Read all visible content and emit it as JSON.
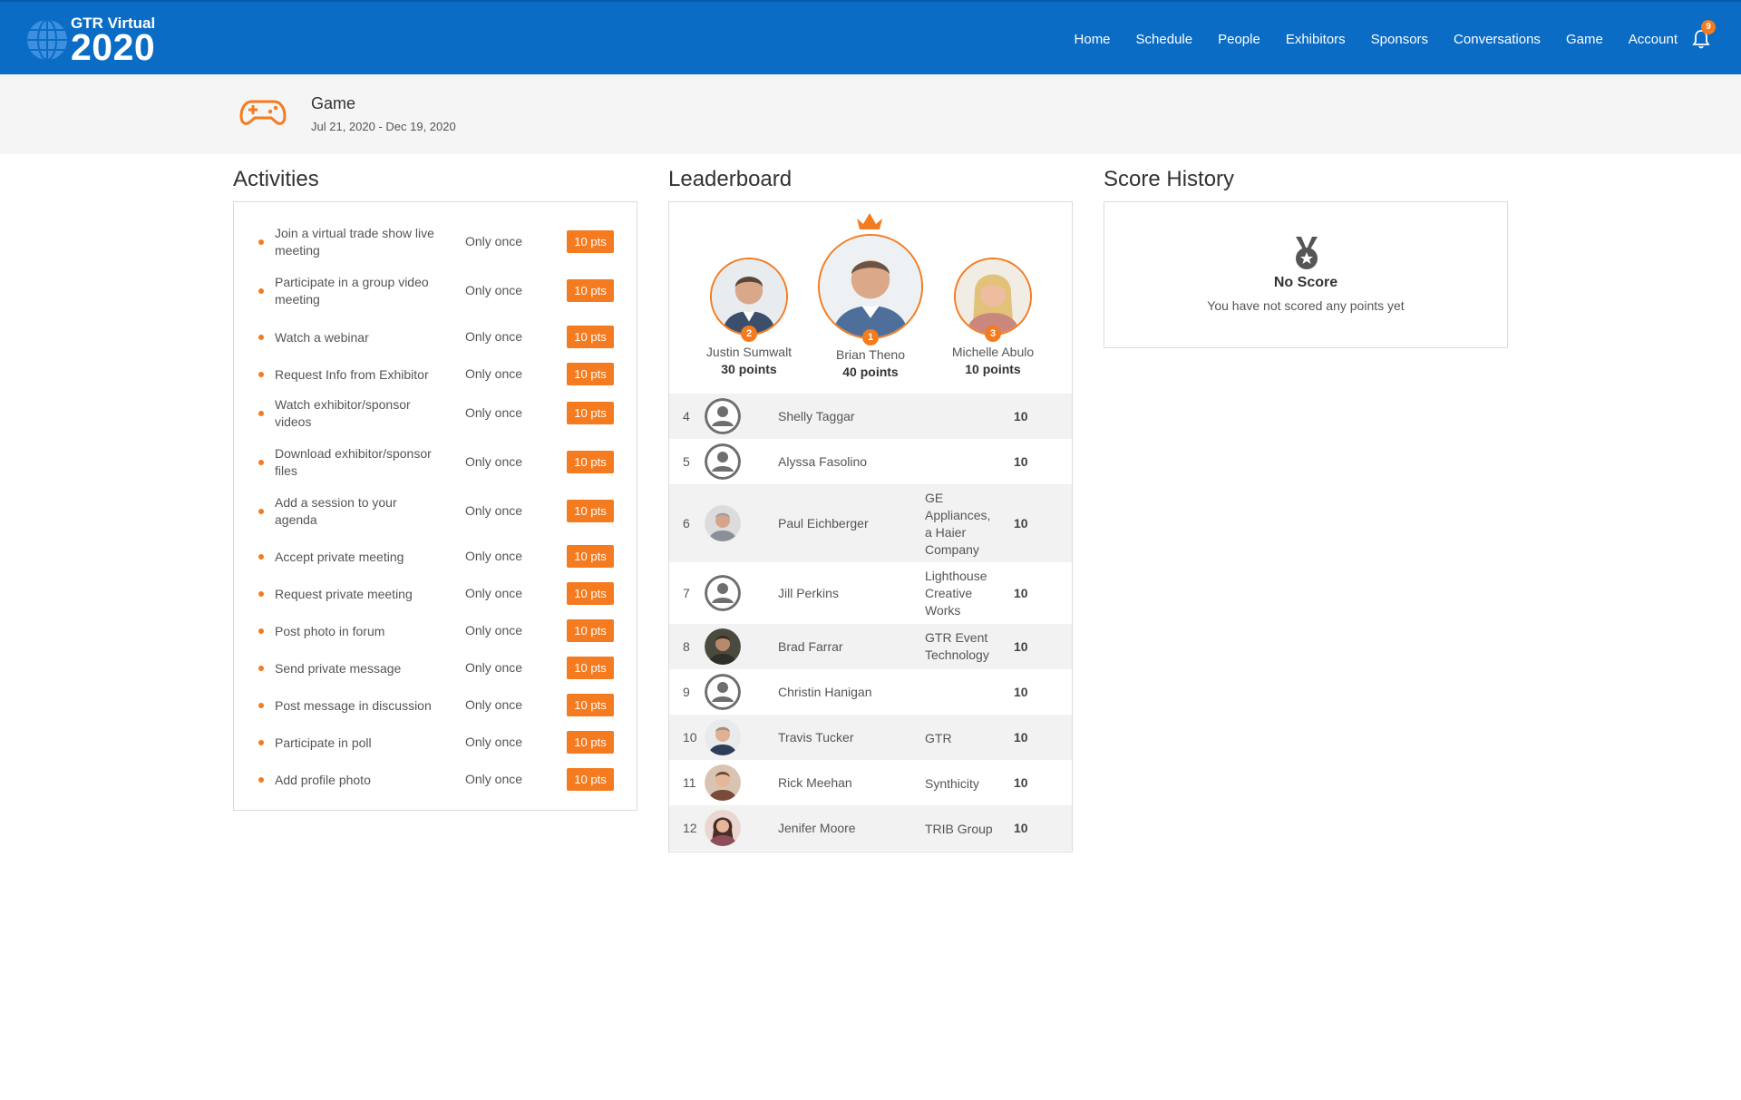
{
  "brand": {
    "line1": "GTR Virtual",
    "line2": "2020"
  },
  "nav": {
    "items": [
      "Home",
      "Schedule",
      "People",
      "Exhibitors",
      "Sponsors",
      "Conversations",
      "Game",
      "Account"
    ],
    "notifications_count": "9"
  },
  "banner": {
    "title": "Game",
    "dates": "Jul 21, 2020 - Dec 19, 2020"
  },
  "activities": {
    "title": "Activities",
    "items": [
      {
        "label": "Join a virtual trade show live meeting",
        "frequency": "Only once",
        "points": "10 pts"
      },
      {
        "label": "Participate in a group video meeting",
        "frequency": "Only once",
        "points": "10 pts"
      },
      {
        "label": "Watch a webinar",
        "frequency": "Only once",
        "points": "10 pts"
      },
      {
        "label": "Request Info from Exhibitor",
        "frequency": "Only once",
        "points": "10 pts"
      },
      {
        "label": "Watch exhibitor/sponsor videos",
        "frequency": "Only once",
        "points": "10 pts"
      },
      {
        "label": "Download exhibitor/sponsor files",
        "frequency": "Only once",
        "points": "10 pts"
      },
      {
        "label": "Add a session to your agenda",
        "frequency": "Only once",
        "points": "10 pts"
      },
      {
        "label": "Accept private meeting",
        "frequency": "Only once",
        "points": "10 pts"
      },
      {
        "label": "Request private meeting",
        "frequency": "Only once",
        "points": "10 pts"
      },
      {
        "label": "Post photo in forum",
        "frequency": "Only once",
        "points": "10 pts"
      },
      {
        "label": "Send private message",
        "frequency": "Only once",
        "points": "10 pts"
      },
      {
        "label": "Post message in discussion",
        "frequency": "Only once",
        "points": "10 pts"
      },
      {
        "label": "Participate in poll",
        "frequency": "Only once",
        "points": "10 pts"
      },
      {
        "label": "Add profile photo",
        "frequency": "Only once",
        "points": "10 pts"
      }
    ]
  },
  "leaderboard": {
    "title": "Leaderboard",
    "podium": [
      {
        "rank": "2",
        "name": "Justin Sumwalt",
        "points": "30 points"
      },
      {
        "rank": "1",
        "name": "Brian Theno",
        "points": "40 points"
      },
      {
        "rank": "3",
        "name": "Michelle Abulo",
        "points": "10 points"
      }
    ],
    "rows": [
      {
        "rank": "4",
        "name": "Shelly Taggar",
        "org": "",
        "score": "10",
        "avatar": "placeholder"
      },
      {
        "rank": "5",
        "name": "Alyssa Fasolino",
        "org": "",
        "score": "10",
        "avatar": "placeholder"
      },
      {
        "rank": "6",
        "name": "Paul Eichberger",
        "org": "GE Appliances, a Haier Company",
        "score": "10",
        "avatar": "photo"
      },
      {
        "rank": "7",
        "name": "Jill Perkins",
        "org": "Lighthouse Creative Works",
        "score": "10",
        "avatar": "placeholder"
      },
      {
        "rank": "8",
        "name": "Brad Farrar",
        "org": "GTR Event Technology",
        "score": "10",
        "avatar": "photo"
      },
      {
        "rank": "9",
        "name": "Christin Hanigan",
        "org": "",
        "score": "10",
        "avatar": "placeholder"
      },
      {
        "rank": "10",
        "name": "Travis Tucker",
        "org": "GTR",
        "score": "10",
        "avatar": "photo"
      },
      {
        "rank": "11",
        "name": "Rick Meehan",
        "org": "Synthicity",
        "score": "10",
        "avatar": "photo"
      },
      {
        "rank": "12",
        "name": "Jenifer Moore",
        "org": "TRIB Group",
        "score": "10",
        "avatar": "photo"
      }
    ]
  },
  "score_history": {
    "title": "Score History",
    "empty_title": "No Score",
    "empty_message": "You have not scored any points yet"
  },
  "colors": {
    "brand_blue": "#0a6cc4",
    "accent_orange": "#f47b20"
  }
}
